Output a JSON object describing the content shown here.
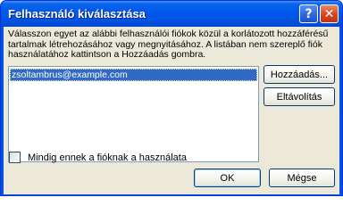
{
  "window": {
    "title": "Felhasználó kiválasztása",
    "help_glyph": "?",
    "close_glyph": "✕"
  },
  "description": "Válasszon egyet az alábbi felhasználói fiókok közül a korlátozott hozzáférésű tartalmak létrehozásához vagy megnyitásához. A listában nem szereplő fiók használatához kattintson a Hozzáadás gombra.",
  "accounts": {
    "items": [
      {
        "email": "zsoltambrus@example.com",
        "selected": true
      }
    ]
  },
  "buttons": {
    "add": "Hozzáadás...",
    "remove": "Eltávolítás",
    "ok": "OK",
    "cancel": "Mégse"
  },
  "checkbox": {
    "label": "Mindig ennek a fióknak a használata",
    "checked": false
  },
  "colors": {
    "titlebar": "#0054e3",
    "client": "#ece9d8",
    "selection": "#316ac5"
  }
}
